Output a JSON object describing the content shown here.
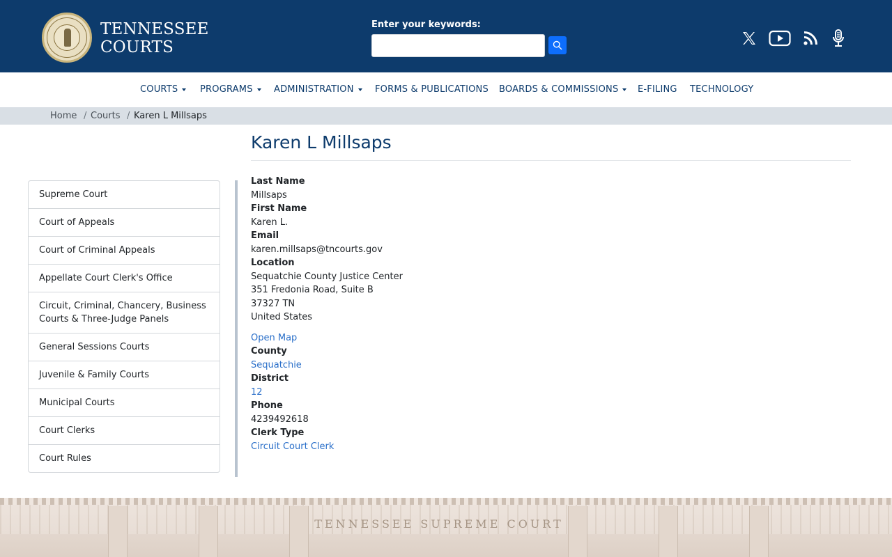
{
  "header": {
    "brand_line1": "TENNESSEE",
    "brand_line2": "COURTS",
    "search_label": "Enter your keywords:",
    "search_value": "",
    "social": [
      "x-icon",
      "youtube-icon",
      "rss-icon",
      "podcast-microphone-icon"
    ]
  },
  "nav": {
    "items": [
      {
        "label": "COURTS",
        "dropdown": true
      },
      {
        "label": "PROGRAMS",
        "dropdown": true
      },
      {
        "label": "ADMINISTRATION",
        "dropdown": true
      },
      {
        "label": "FORMS & PUBLICATIONS",
        "dropdown": false
      },
      {
        "label": "BOARDS & COMMISSIONS",
        "dropdown": true
      },
      {
        "label": "E-FILING",
        "dropdown": false
      },
      {
        "label": "TECHNOLOGY",
        "dropdown": false
      }
    ]
  },
  "breadcrumb": {
    "home": "Home",
    "courts": "Courts",
    "current": "Karen L Millsaps"
  },
  "page": {
    "title": "Karen L Millsaps"
  },
  "sidebar": {
    "items": [
      {
        "label": "Supreme Court"
      },
      {
        "label": "Court of Appeals"
      },
      {
        "label": "Court of Criminal Appeals"
      },
      {
        "label": "Appellate Court Clerk's Office"
      },
      {
        "label": "Circuit, Criminal, Chancery, Business Courts & Three-Judge Panels"
      },
      {
        "label": "General Sessions Courts"
      },
      {
        "label": "Juvenile & Family Courts"
      },
      {
        "label": "Municipal Courts"
      },
      {
        "label": "Court Clerks"
      },
      {
        "label": "Court Rules"
      }
    ]
  },
  "details": {
    "last_name_label": "Last Name",
    "last_name": "Millsaps",
    "first_name_label": "First Name",
    "first_name": "Karen L.",
    "email_label": "Email",
    "email": "karen.millsaps@tncourts.gov",
    "location_label": "Location",
    "location_line1": "Sequatchie County Justice Center",
    "location_line2": "351 Fredonia Road, Suite B",
    "location_line3": "37327 TN",
    "location_line4": "United States",
    "open_map": "Open Map",
    "county_label": "County",
    "county": "Sequatchie",
    "district_label": "District",
    "district": "12",
    "phone_label": "Phone",
    "phone": "4239492618",
    "clerk_type_label": "Clerk Type",
    "clerk_type": "Circuit Court Clerk"
  },
  "banner": {
    "inscription": "TENNESSEE SUPREME COURT"
  },
  "colors": {
    "header_bg": "#0d3b6c",
    "link": "#2a6fc9",
    "search_button": "#0d6efd",
    "breadcrumb_bg": "#d9dfe5"
  }
}
